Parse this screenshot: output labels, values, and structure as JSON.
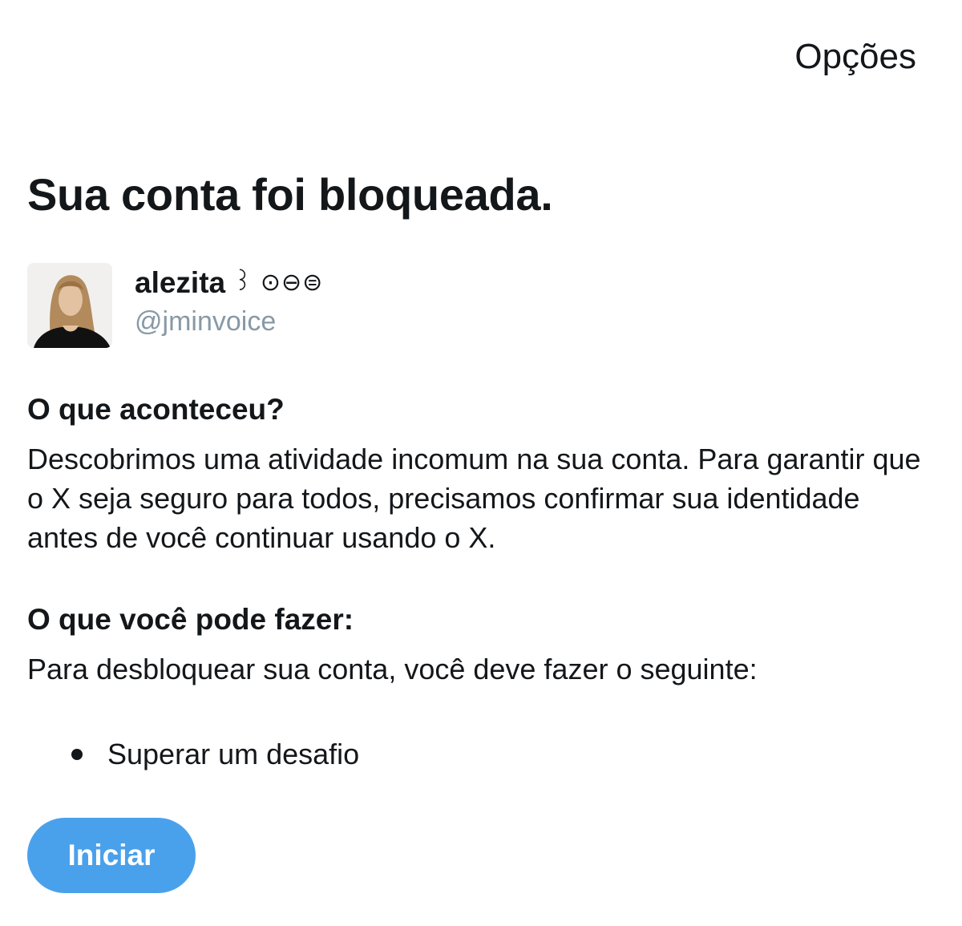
{
  "header": {
    "options_label": "Opções"
  },
  "page": {
    "title": "Sua conta foi bloqueada."
  },
  "profile": {
    "display_name": "alezita",
    "name_suffix": "꒱ ⊙⊖⊜",
    "handle": "@jminvoice"
  },
  "what_happened": {
    "heading": "O que aconteceu?",
    "body": "Descobrimos uma atividade incomum na sua conta. Para garantir que o X seja seguro para todos, precisamos confirmar sua identidade antes de você continuar usando o X."
  },
  "what_you_can_do": {
    "heading": "O que você pode fazer:",
    "body": "Para desbloquear sua conta, você deve fazer o seguinte:",
    "steps": [
      {
        "label": "Superar um desafio"
      }
    ]
  },
  "actions": {
    "start_label": "Iniciar"
  },
  "colors": {
    "accent": "#4aa1eb",
    "text": "#14171a",
    "muted": "#8899a6"
  }
}
